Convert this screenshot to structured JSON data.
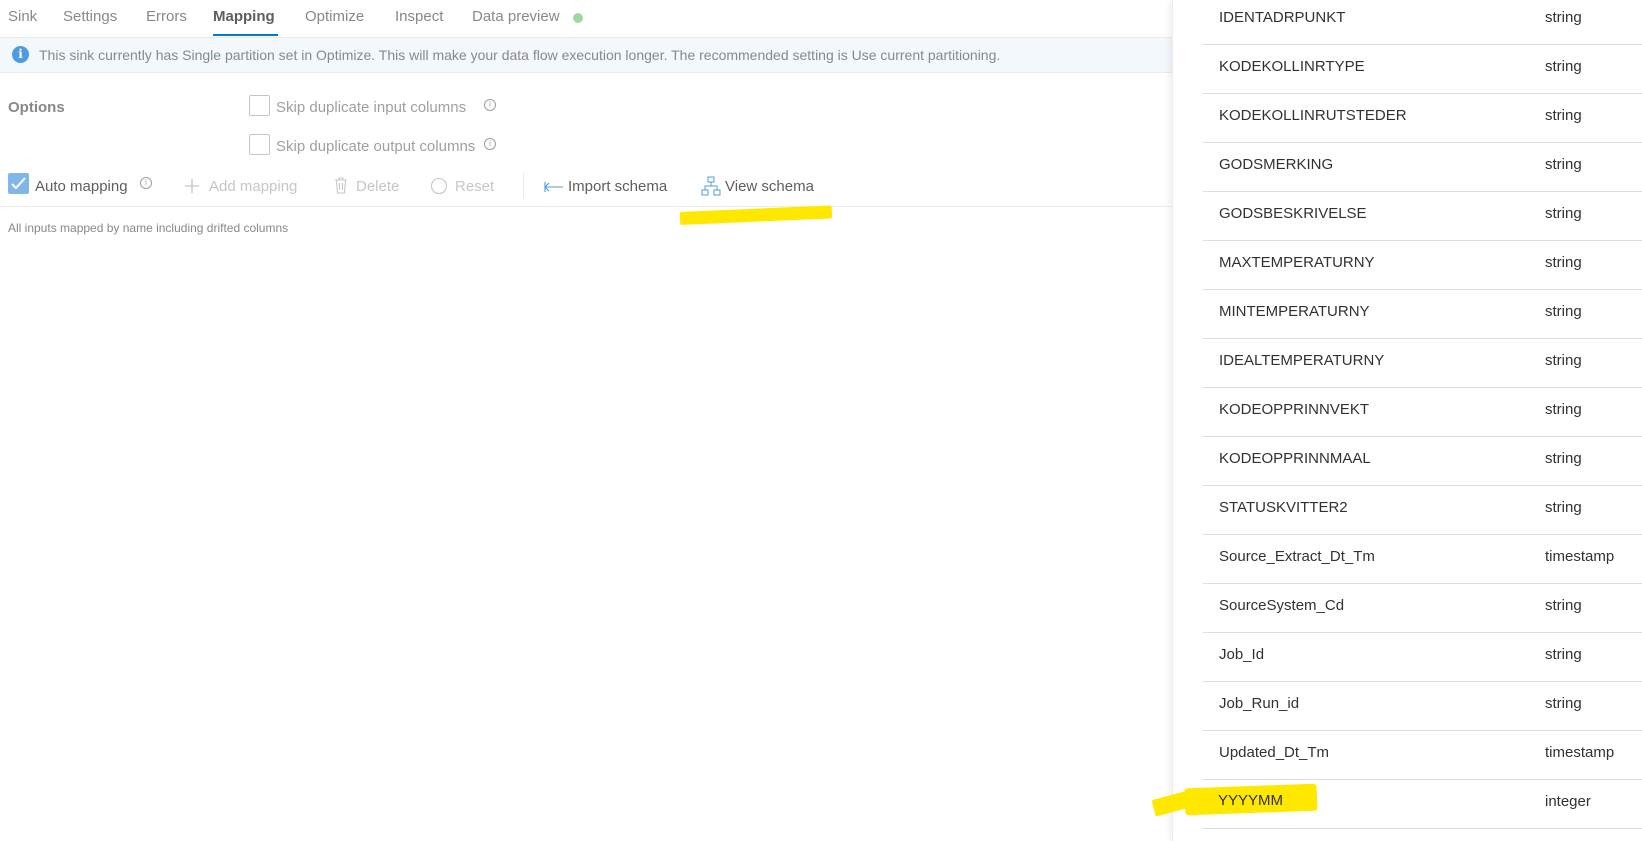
{
  "tabs": [
    {
      "label": "Sink"
    },
    {
      "label": "Settings"
    },
    {
      "label": "Errors"
    },
    {
      "label": "Mapping"
    },
    {
      "label": "Optimize"
    },
    {
      "label": "Inspect"
    },
    {
      "label": "Data preview"
    }
  ],
  "active_tab": "Mapping",
  "info_message": "This sink currently has Single partition set in Optimize. This will make your data flow execution longer. The recommended setting is Use current partitioning.",
  "options": {
    "label": "Options",
    "skip_input_label": "Skip duplicate input columns",
    "skip_output_label": "Skip duplicate output columns",
    "skip_input_checked": false,
    "skip_output_checked": false
  },
  "toolbar": {
    "auto_mapping_label": "Auto mapping",
    "auto_mapping_checked": true,
    "add_mapping_label": "Add mapping",
    "delete_label": "Delete",
    "reset_label": "Reset",
    "import_schema_label": "Import schema",
    "view_schema_label": "View schema"
  },
  "hint": "All inputs mapped by name including drifted columns",
  "colors": {
    "accent": "#0078d4",
    "highlight": "#ffe800",
    "status_dot": "#9fd89f"
  },
  "schema": [
    {
      "name": "IDENTADRPUNKT",
      "type": "string"
    },
    {
      "name": "KODEKOLLINRTYPE",
      "type": "string"
    },
    {
      "name": "KODEKOLLINRUTSTEDER",
      "type": "string"
    },
    {
      "name": "GODSMERKING",
      "type": "string"
    },
    {
      "name": "GODSBESKRIVELSE",
      "type": "string"
    },
    {
      "name": "MAXTEMPERATURNY",
      "type": "string"
    },
    {
      "name": "MINTEMPERATURNY",
      "type": "string"
    },
    {
      "name": "IDEALTEMPERATURNY",
      "type": "string"
    },
    {
      "name": "KODEOPPRINNVEKT",
      "type": "string"
    },
    {
      "name": "KODEOPPRINNMAAL",
      "type": "string"
    },
    {
      "name": "STATUSKVITTER2",
      "type": "string"
    },
    {
      "name": "Source_Extract_Dt_Tm",
      "type": "timestamp"
    },
    {
      "name": "SourceSystem_Cd",
      "type": "string"
    },
    {
      "name": "Job_Id",
      "type": "string"
    },
    {
      "name": "Job_Run_id",
      "type": "string"
    },
    {
      "name": "Updated_Dt_Tm",
      "type": "timestamp"
    },
    {
      "name": "YYYYMM",
      "type": "integer"
    }
  ]
}
